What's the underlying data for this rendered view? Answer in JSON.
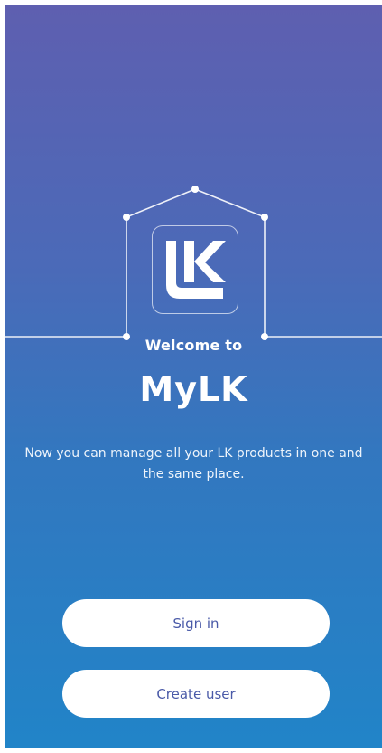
{
  "welcome": {
    "greeting": "Welcome to",
    "app_name": "MyLK",
    "description": "Now you can manage all your LK products in one and the same place."
  },
  "logo": {
    "text": "LK",
    "icon": "lk-logo-icon"
  },
  "actions": {
    "sign_in_label": "Sign in",
    "create_user_label": "Create user"
  },
  "colors": {
    "gradient_top": "#5e5fb0",
    "gradient_bottom": "#2184c8",
    "button_bg": "#ffffff",
    "button_text": "#4a5aa8"
  }
}
